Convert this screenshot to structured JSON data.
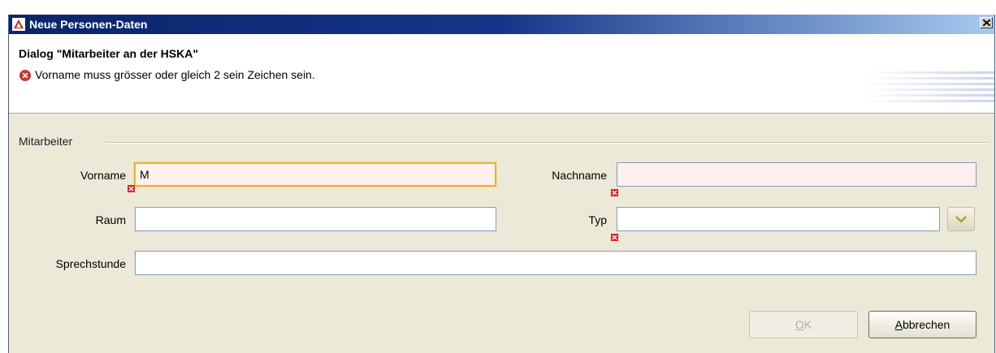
{
  "window": {
    "title": "Neue Personen-Daten",
    "app_icon": "app-icon",
    "close_icon": "close-icon"
  },
  "header": {
    "dialog_title": "Dialog \"Mitarbeiter an der HSKA\"",
    "error_icon": "error-icon",
    "error_message": "Vorname muss grösser oder gleich 2 sein Zeichen sein."
  },
  "group": {
    "label": "Mitarbeiter"
  },
  "fields": {
    "vorname": {
      "label": "Vorname",
      "value": "M"
    },
    "nachname": {
      "label": "Nachname",
      "value": ""
    },
    "raum": {
      "label": "Raum",
      "value": ""
    },
    "typ": {
      "label": "Typ",
      "value": ""
    },
    "sprechstunde": {
      "label": "Sprechstunde",
      "value": ""
    }
  },
  "buttons": {
    "ok_mnemonic": "O",
    "ok_rest": "K",
    "cancel_mnemonic": "A",
    "cancel_rest": "bbrechen"
  },
  "colors": {
    "title_bar": "#0a246a",
    "error": "#d9322b",
    "focus_border": "#e8b52a",
    "invalid_bg": "#fff0f0"
  }
}
